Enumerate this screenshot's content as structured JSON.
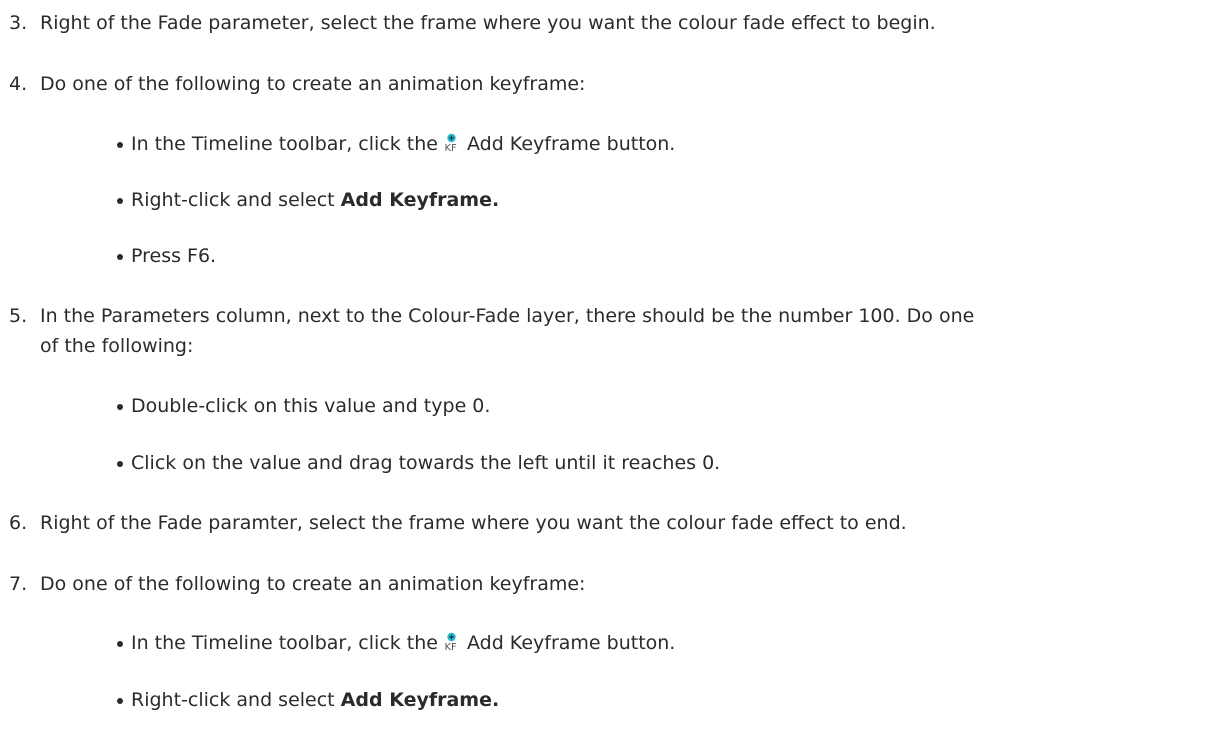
{
  "steps": [
    {
      "number": "3.",
      "text": "Right of the Fade parameter, select the frame where you want the colour fade effect to begin."
    },
    {
      "number": "4.",
      "text": "Do one of the following to create an animation keyframe:",
      "bullets": [
        {
          "before": "In the Timeline toolbar, click the",
          "icon": "add-keyframe-icon",
          "after": "Add Keyframe button."
        },
        {
          "before": "Right-click and select",
          "bold": "Add Keyframe."
        },
        {
          "before": "Press F6."
        }
      ]
    },
    {
      "number": "5.",
      "text_line1": "In the Parameters column, next to the Colour-Fade layer, there should be the number 100. Do one",
      "text_line2": "of the following:",
      "bullets": [
        {
          "before": "Double-click on this value and type 0."
        },
        {
          "before": "Click on the value and drag towards the left until it reaches 0."
        }
      ]
    },
    {
      "number": "6.",
      "text": "Right of the Fade paramter, select the frame where you want the colour fade effect to end."
    },
    {
      "number": "7.",
      "text": "Do one of the following to create an animation keyframe:",
      "bullets": [
        {
          "before": "In the Timeline toolbar, click the",
          "icon": "add-keyframe-icon",
          "after": "Add Keyframe button."
        },
        {
          "before": "Right-click and select",
          "bold": "Add Keyframe."
        }
      ]
    }
  ],
  "icon": {
    "label": "KF",
    "accent": "#22b8cf",
    "text_color": "#555555"
  }
}
